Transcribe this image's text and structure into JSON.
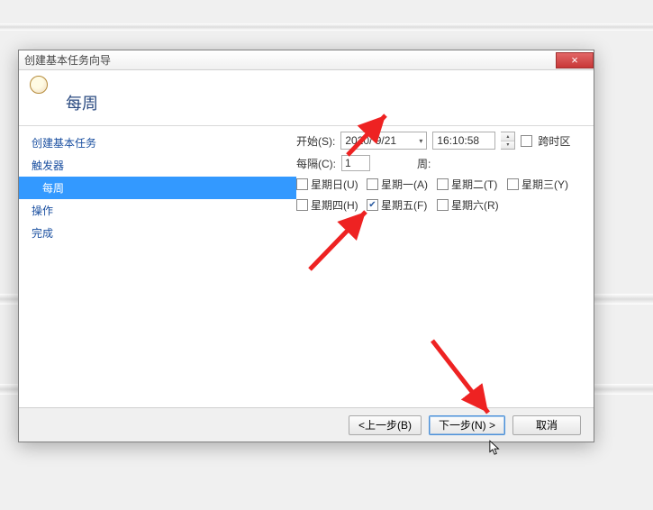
{
  "dialog": {
    "title": "创建基本任务向导",
    "header_title": "每周",
    "close_x": "×"
  },
  "nav": {
    "items": [
      {
        "label": "创建基本任务",
        "indent": false,
        "selected": false
      },
      {
        "label": "触发器",
        "indent": false,
        "selected": false
      },
      {
        "label": "每周",
        "indent": true,
        "selected": true
      },
      {
        "label": "操作",
        "indent": false,
        "selected": false
      },
      {
        "label": "完成",
        "indent": false,
        "selected": false
      }
    ]
  },
  "form": {
    "start_label": "开始(S):",
    "date_value": "2020/ 9/21",
    "time_value": "16:10:58",
    "cross_tz_label": "跨时区",
    "cross_tz_checked": false,
    "recur_label": "每隔(C):",
    "recur_value": "1",
    "recur_unit": "周:",
    "days": [
      {
        "label": "星期日(U)",
        "checked": false
      },
      {
        "label": "星期一(A)",
        "checked": false
      },
      {
        "label": "星期二(T)",
        "checked": false
      },
      {
        "label": "星期三(Y)",
        "checked": false
      },
      {
        "label": "星期四(H)",
        "checked": false
      },
      {
        "label": "星期五(F)",
        "checked": true
      },
      {
        "label": "星期六(R)",
        "checked": false
      }
    ]
  },
  "buttons": {
    "back": "<上一步(B)",
    "next": "下一步(N) >",
    "cancel": "取消"
  }
}
